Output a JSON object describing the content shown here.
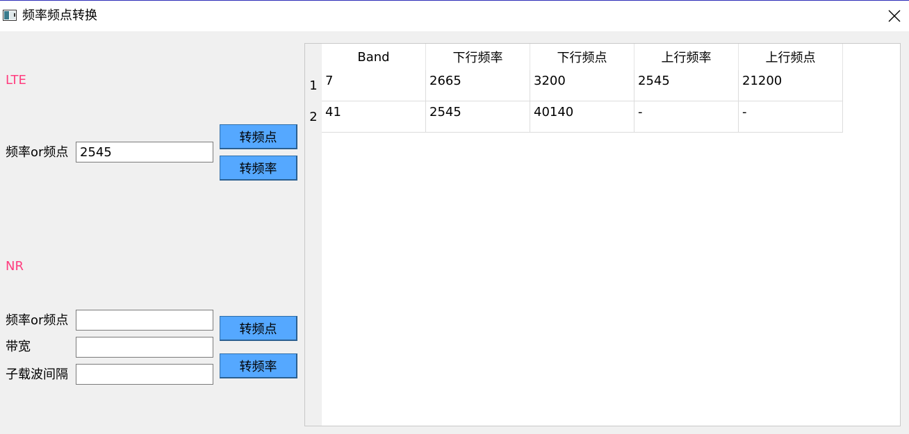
{
  "window": {
    "title": "频率频点转换"
  },
  "lte": {
    "section_label": "LTE",
    "freq_label": "频率or频点",
    "freq_value": "2545",
    "to_earfcn_button": "转频点",
    "to_freq_button": "转频率"
  },
  "nr": {
    "section_label": "NR",
    "freq_label": "频率or频点",
    "freq_value": "",
    "bandwidth_label": "带宽",
    "bandwidth_value": "",
    "scs_label": "子载波间隔",
    "scs_value": "",
    "to_arfcn_button": "转频点",
    "to_freq_button": "转频率"
  },
  "table": {
    "columns": [
      "Band",
      "下行频率",
      "下行频点",
      "上行频率",
      "上行频点"
    ],
    "rows": [
      {
        "num": "1",
        "cells": [
          "7",
          "2665",
          "3200",
          "2545",
          "21200"
        ]
      },
      {
        "num": "2",
        "cells": [
          "41",
          "2545",
          "40140",
          "-",
          "-"
        ]
      }
    ]
  },
  "colors": {
    "section_label": "#ff3d7f",
    "button": "#55a8ff"
  }
}
